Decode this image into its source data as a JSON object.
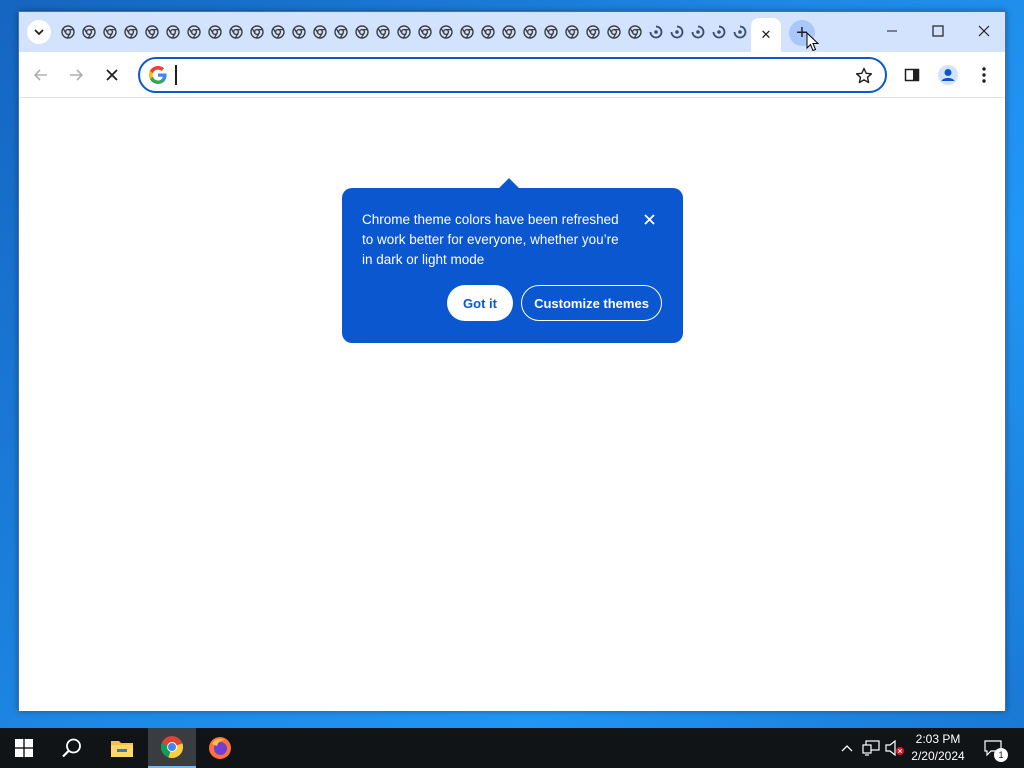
{
  "window": {
    "tab_count_visible": 33,
    "active_tab_close_glyph": "✕",
    "new_tab_glyph": "+",
    "controls": {
      "minimize_glyph": "—",
      "maximize_glyph": "☐",
      "close_glyph": "✕"
    }
  },
  "toolbar": {
    "address_value": "",
    "address_placeholder": "",
    "back_enabled": false,
    "forward_enabled": false
  },
  "theme_bubble": {
    "message": "Chrome theme colors have been refreshed to work better for everyone, whether you’re in dark or light mode",
    "got_it_label": "Got it",
    "customize_label": "Customize themes"
  },
  "taskbar": {
    "time": "2:03 PM",
    "date": "2/20/2024",
    "notification_count": "1",
    "pinned_apps": [
      "file-explorer",
      "chrome",
      "firefox"
    ],
    "active_app": "chrome"
  },
  "colors": {
    "accent": "#0b57d0",
    "tabstrip": "#d3e3fd",
    "desktop": "#1e88e5",
    "taskbar": "#111417"
  }
}
